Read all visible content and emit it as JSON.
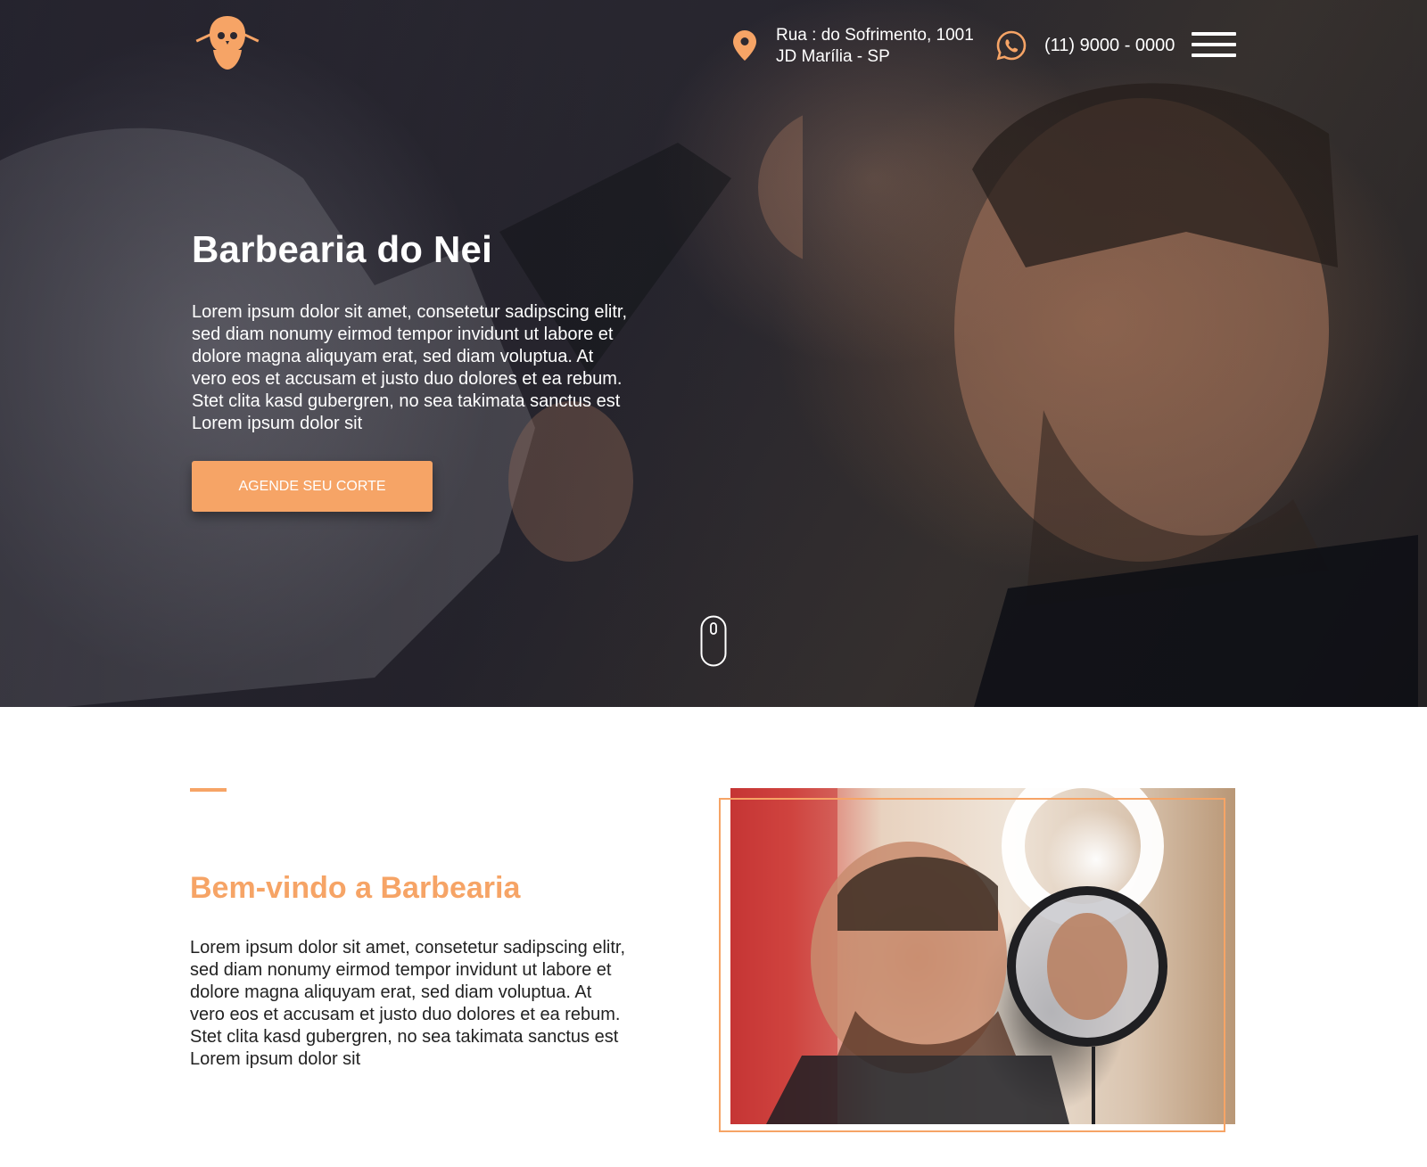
{
  "header": {
    "logo_name": "barber-skull-logo",
    "address_line1": "Rua : do Sofrimento, 1001",
    "address_line2": "JD Marília - SP",
    "phone": "(11) 9000 - 0000"
  },
  "hero": {
    "title": "Barbearia do Nei",
    "text": "Lorem ipsum dolor sit amet, consetetur sadipscing elitr, sed diam nonumy eirmod tempor invidunt ut labore et dolore magna aliquyam erat, sed diam voluptua. At vero eos et accusam et justo duo dolores et ea rebum. Stet clita kasd gubergren, no sea takimata sanctus est Lorem ipsum dolor sit",
    "cta_label": "AGENDE SEU CORTE"
  },
  "welcome": {
    "title": "Bem-vindo a Barbearia",
    "text": "Lorem ipsum dolor sit amet, consetetur sadipscing elitr, sed diam nonumy eirmod tempor invidunt ut labore et dolore magna aliquyam erat, sed diam voluptua. At vero eos et accusam et justo duo dolores et ea rebum. Stet clita kasd gubergren, no sea takimata sanctus est Lorem ipsum dolor sit"
  },
  "colors": {
    "accent": "#f6a466",
    "hero_text": "#ffffff",
    "body_text": "#222222"
  },
  "icons": [
    "barber-skull-logo",
    "location-pin-icon",
    "whatsapp-icon",
    "hamburger-menu-icon",
    "scroll-mouse-icon"
  ]
}
